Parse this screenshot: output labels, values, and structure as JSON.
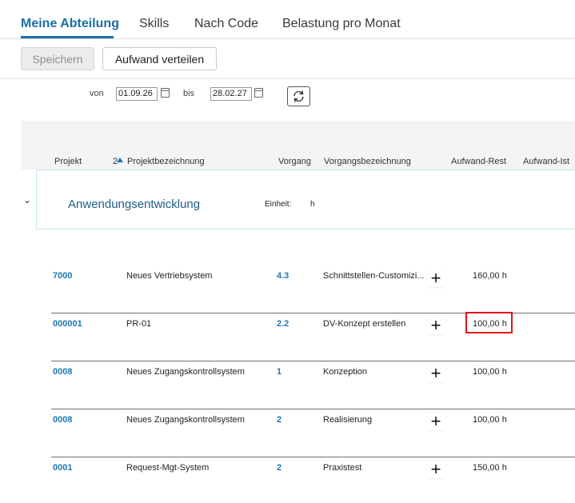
{
  "tabs": [
    {
      "label": "Meine Abteilung",
      "active": true
    },
    {
      "label": "Skills",
      "active": false
    },
    {
      "label": "Nach Code",
      "active": false
    },
    {
      "label": "Belastung pro Monat",
      "active": false
    }
  ],
  "toolbar": {
    "save_label": "Speichern",
    "distribute_label": "Aufwand verteilen"
  },
  "filter": {
    "from_label": "von",
    "from_value": "01.09.26",
    "to_label": "bis",
    "to_value": "28.02.27"
  },
  "columns": {
    "projekt": "Projekt",
    "sort_index": "2",
    "projektbezeichnung": "Projektbezeichnung",
    "vorgang": "Vorgang",
    "vorgangsbezeichnung": "Vorgangsbezeichnung",
    "aufwand_rest": "Aufwand-Rest",
    "aufwand_ist": "Aufwand-Ist"
  },
  "group": {
    "title": "Anwendungsentwicklung",
    "unit_label": "Einheit:",
    "unit_value": "h"
  },
  "rows": [
    {
      "projekt": "7000",
      "projektbezeichnung": "Neues Vertriebsystem",
      "vorgang": "4.3",
      "vorgangsbezeichnung": "Schnittstellen-Customizi...",
      "aufwand_rest": "160,00 h"
    },
    {
      "projekt": "000001",
      "projektbezeichnung": "PR-01",
      "vorgang": "2.2",
      "vorgangsbezeichnung": "DV-Konzept erstellen",
      "aufwand_rest": "100,00 h"
    },
    {
      "projekt": "0008",
      "projektbezeichnung": "Neues Zugangskontrollsystem",
      "vorgang": "1",
      "vorgangsbezeichnung": "Konzeption",
      "aufwand_rest": "100,00 h"
    },
    {
      "projekt": "0008",
      "projektbezeichnung": "Neues Zugangskontrollsystem",
      "vorgang": "2",
      "vorgangsbezeichnung": "Realisierung",
      "aufwand_rest": "100,00 h"
    },
    {
      "projekt": "0001",
      "projektbezeichnung": "Request-Mgt-System",
      "vorgang": "2",
      "vorgangsbezeichnung": "Praxistest",
      "aufwand_rest": "150,00 h"
    }
  ],
  "icons": {
    "calendar": "calendar-icon",
    "refresh": "refresh-icon",
    "plus": "plus-icon",
    "sort": "sort-asc-icon",
    "chevron": "chevron-down-icon"
  },
  "colors": {
    "accent": "#1a6ea8",
    "link": "#1a78b4",
    "highlight": "#e0101a"
  }
}
